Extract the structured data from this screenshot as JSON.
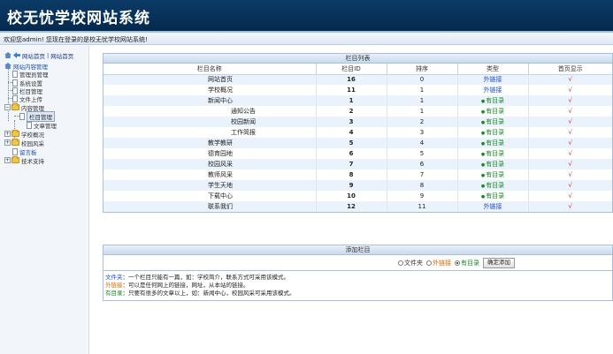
{
  "header": {
    "title": "校无忧学校网站系统"
  },
  "welcome": {
    "text": "欢迎您admin! 您现在登录的是校无忧学校网站系统!"
  },
  "sidebar": {
    "top_links": [
      "网站首页",
      "网站首页"
    ],
    "items": [
      {
        "label": "网站内容管理"
      },
      {
        "label": "管理员管理"
      },
      {
        "label": "系统设置"
      },
      {
        "label": "栏目管理"
      },
      {
        "label": "文件上传"
      },
      {
        "label": "内容管理"
      },
      {
        "label": "栏目管理"
      },
      {
        "label": "文章管理"
      },
      {
        "label": "学校概况"
      },
      {
        "label": "校园风采"
      },
      {
        "label": "留言板"
      },
      {
        "label": "技术支持"
      }
    ]
  },
  "column_list": {
    "title": "栏目列表",
    "headers": [
      "栏目名称",
      "栏目ID",
      "排序",
      "类型",
      "首页显示"
    ],
    "rows": [
      {
        "name": "网站首页",
        "id": "16",
        "order": "0",
        "type": "外链接",
        "show": "√"
      },
      {
        "name": "学校概况",
        "id": "11",
        "order": "1",
        "type": "外链接",
        "show": "√"
      },
      {
        "name": "新闻中心",
        "id": "1",
        "order": "1",
        "type": "有目录",
        "show": "√"
      },
      {
        "name": "通知公告",
        "id": "2",
        "order": "1",
        "type": "有目录",
        "show": "√"
      },
      {
        "name": "校园新闻",
        "id": "3",
        "order": "2",
        "type": "有目录",
        "show": "√"
      },
      {
        "name": "工作简报",
        "id": "4",
        "order": "3",
        "type": "有目录",
        "show": "√"
      },
      {
        "name": "教学教研",
        "id": "5",
        "order": "4",
        "type": "有目录",
        "show": "√"
      },
      {
        "name": "德育园地",
        "id": "6",
        "order": "5",
        "type": "有目录",
        "show": "√"
      },
      {
        "name": "校园风采",
        "id": "7",
        "order": "6",
        "type": "有目录",
        "show": "√"
      },
      {
        "name": "教师风采",
        "id": "8",
        "order": "7",
        "type": "有目录",
        "show": "√"
      },
      {
        "name": "学生天地",
        "id": "9",
        "order": "8",
        "type": "有目录",
        "show": "√"
      },
      {
        "name": "下载中心",
        "id": "10",
        "order": "9",
        "type": "有目录",
        "show": "√"
      },
      {
        "name": "联系我们",
        "id": "12",
        "order": "11",
        "type": "外链接",
        "show": "√"
      }
    ]
  },
  "add_column": {
    "title": "添加栏目",
    "options": [
      "文件夹",
      "外链接",
      "有目录"
    ],
    "selected": "有目录",
    "button_label": "确定添加"
  },
  "notes": [
    {
      "key": "文件夹",
      "text": "：一个栏目只能有一篇，如：学校简介，联系方式可采用该模式。"
    },
    {
      "key": "外链接",
      "text": "：可以是任何网上的链接，网址，从本站的链接。"
    },
    {
      "key": "有目录",
      "text": "：只要有很多的文章以上，如：新闻中心，校园风采可采用该模式。"
    }
  ]
}
